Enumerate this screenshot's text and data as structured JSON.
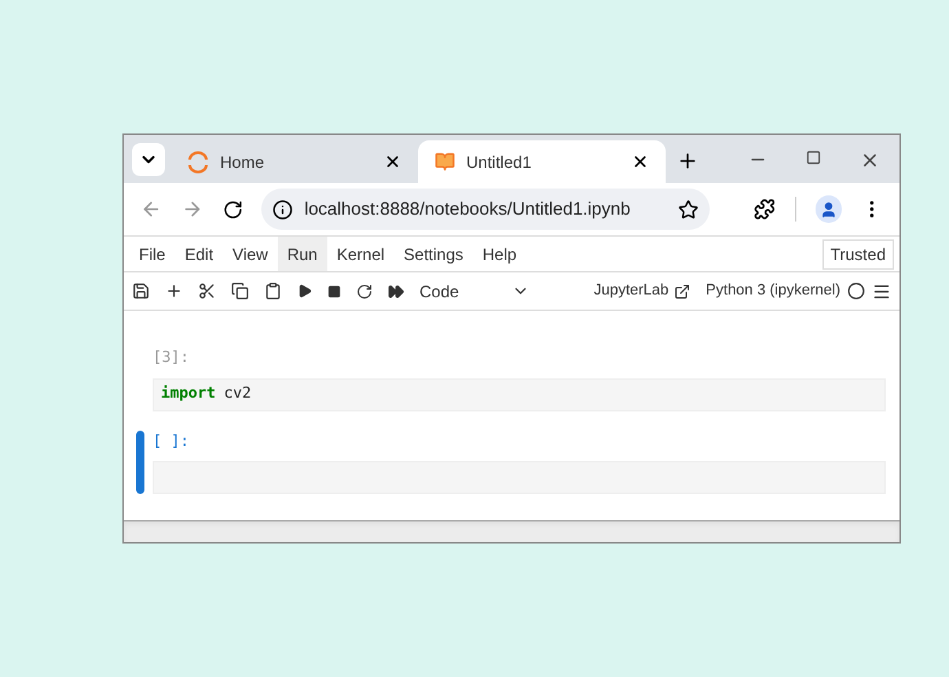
{
  "tabs": [
    {
      "title": "Home",
      "kind": "jupyter",
      "selected": false
    },
    {
      "title": "Untitled1",
      "kind": "notebook",
      "selected": true
    }
  ],
  "address": {
    "url": "localhost:8888/notebooks/Untitled1.ipynb"
  },
  "menu": [
    {
      "label": "File",
      "selected": false
    },
    {
      "label": "Edit",
      "selected": false
    },
    {
      "label": "View",
      "selected": false
    },
    {
      "label": "Run",
      "selected": true
    },
    {
      "label": "Kernel",
      "selected": false
    },
    {
      "label": "Settings",
      "selected": false
    },
    {
      "label": "Help",
      "selected": false
    }
  ],
  "trusted": "Trusted",
  "toolbar": {
    "cell_type": "Code",
    "jupyterlab": "JupyterLab",
    "kernel": "Python 3 (ipykernel)"
  },
  "cells": [
    {
      "prompt": "[3]:",
      "selected": false,
      "tokens": [
        {
          "kind": "keyword",
          "text": "import"
        },
        {
          "kind": "plain",
          "text": "cv2"
        }
      ]
    },
    {
      "prompt": "[ ]:",
      "selected": true
    }
  ]
}
